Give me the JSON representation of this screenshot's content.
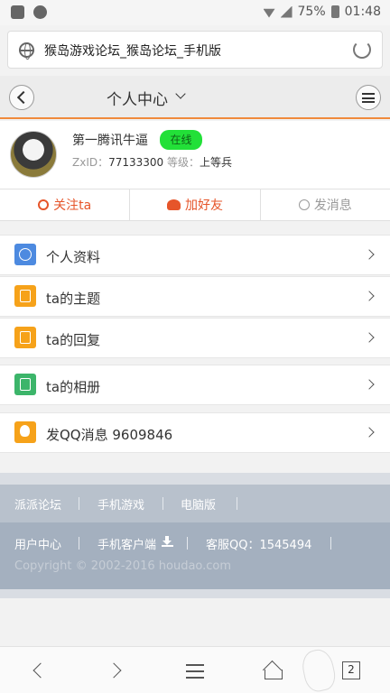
{
  "status": {
    "battery": "75%",
    "time": "01:48"
  },
  "browser": {
    "url_title": "猴岛游戏论坛_猴岛论坛_手机版",
    "tabs_count": "2"
  },
  "header": {
    "title": "个人中心"
  },
  "profile": {
    "username": "第一腾讯牛逼",
    "status_badge": "在线",
    "zxid_label": "ZxID：",
    "zxid_value": "77133300",
    "level_label": "等级：",
    "level_value": "上等兵"
  },
  "actions": {
    "follow": "关注ta",
    "add_friend": "加好友",
    "message": "发消息"
  },
  "menu": {
    "profile_info": "个人资料",
    "threads": "ta的主题",
    "replies": "ta的回复",
    "album": "ta的相册",
    "qq": "发QQ消息 9609846"
  },
  "footer": {
    "links1": [
      "派派论坛",
      "手机游戏",
      "电脑版"
    ],
    "user_center": "用户中心",
    "mobile_client": "手机客户端",
    "service_qq": "客服QQ：1545494",
    "copyright": "Copyright © 2002-2016 houdao.com"
  },
  "colors": {
    "accent": "#f08a3c",
    "action": "#e6552a",
    "online": "#22e038",
    "footer": "#a4b0bf"
  }
}
